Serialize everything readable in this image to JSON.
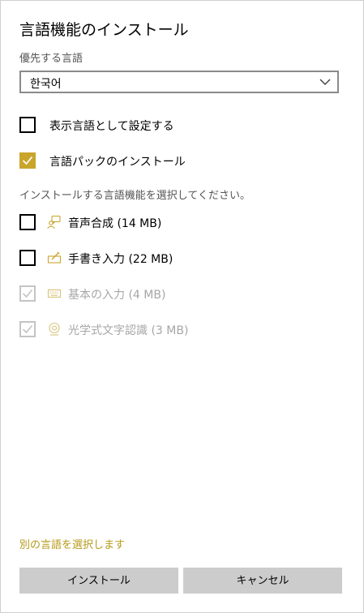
{
  "dialog": {
    "title": "言語機能のインストール",
    "preferred_language_label": "優先する言語",
    "selected_language": "한국어",
    "options": [
      {
        "label": "表示言語として設定する",
        "checked": false
      },
      {
        "label": "言語パックのインストール",
        "checked": true
      }
    ],
    "instruction": "インストールする言語機能を選択してください。",
    "features": [
      {
        "label": "音声合成 (14 MB)",
        "icon": "speech-icon",
        "checked": false,
        "enabled": true
      },
      {
        "label": "手書き入力 (22 MB)",
        "icon": "pen-icon",
        "checked": false,
        "enabled": true
      },
      {
        "label": "基本の入力 (4 MB)",
        "icon": "keyboard-icon",
        "checked": true,
        "enabled": false
      },
      {
        "label": "光学式文字認識 (3 MB)",
        "icon": "camera-icon",
        "checked": true,
        "enabled": false
      }
    ],
    "choose_other_link": "別の言語を選択します",
    "install_button": "インストール",
    "cancel_button": "キャンセル"
  },
  "colors": {
    "accent": "#c9a52c",
    "link": "#b79a1a",
    "button_bg": "#cccccc",
    "disabled_text": "#a6a6a6"
  }
}
